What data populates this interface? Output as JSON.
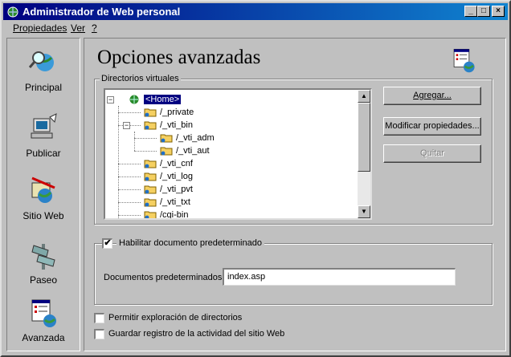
{
  "window": {
    "title": "Administrador de Web personal"
  },
  "menu": [
    "Propiedades",
    "Ver",
    "?"
  ],
  "sidebar": [
    {
      "label": "Principal",
      "icon": "magnifier-globe-icon"
    },
    {
      "label": "Publicar",
      "icon": "computer-publish-icon"
    },
    {
      "label": "Sitio Web",
      "icon": "globe-tools-icon"
    },
    {
      "label": "Paseo",
      "icon": "signpost-icon"
    },
    {
      "label": "Avanzada",
      "icon": "settings-document-icon"
    }
  ],
  "main": {
    "title": "Opciones avanzadas",
    "vdir": {
      "label": "Directorios virtuales",
      "tree": [
        {
          "label": "<Home>",
          "level": 0,
          "expander": "−",
          "selected": true
        },
        {
          "label": "/_private",
          "level": 1
        },
        {
          "label": "/_vti_bin",
          "level": 1,
          "expander": "−"
        },
        {
          "label": "/_vti_adm",
          "level": 2
        },
        {
          "label": "/_vti_aut",
          "level": 2
        },
        {
          "label": "/_vti_cnf",
          "level": 1
        },
        {
          "label": "/_vti_log",
          "level": 1
        },
        {
          "label": "/_vti_pvt",
          "level": 1
        },
        {
          "label": "/_vti_txt",
          "level": 1
        },
        {
          "label": "/cgi-bin",
          "level": 1
        }
      ],
      "buttons": {
        "add": "Agregar...",
        "modify": "Modificar propiedades...",
        "remove": "Quitar"
      }
    },
    "default_doc": {
      "enable_label": "Habilitar documento predeterminado",
      "enabled": "✔",
      "docs_label": "Documentos predeterminados:",
      "docs_value": "index.asp"
    },
    "browse_label": "Permitir exploración de directorios",
    "log_label": "Guardar registro de la actividad del sitio Web"
  }
}
